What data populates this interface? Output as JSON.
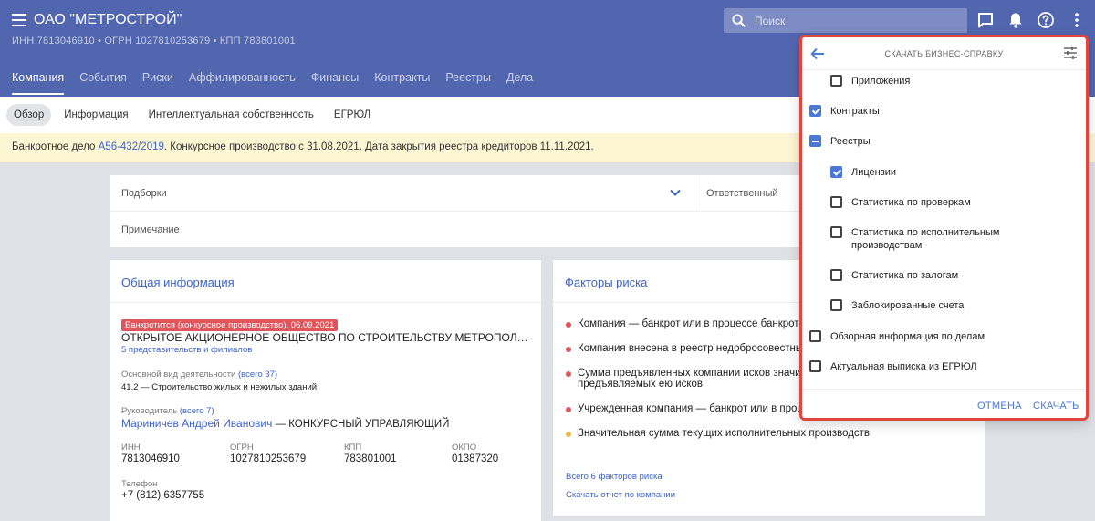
{
  "header": {
    "title": "ОАО \"МЕТРОСТРОЙ\"",
    "ids": "ИНН 7813046910  •  ОГРН 1027810253679  •  КПП 783801001",
    "search_placeholder": "Поиск",
    "tabs": [
      "Компания",
      "События",
      "Риски",
      "Аффилированность",
      "Финансы",
      "Контракты",
      "Реестры",
      "Дела"
    ]
  },
  "subnav": [
    "Обзор",
    "Информация",
    "Интеллектуальная собственность",
    "ЕГРЮЛ"
  ],
  "banner": {
    "prefix": "Банкротное дело ",
    "case_link": "А56-432/2019",
    "suffix": ". Конкурсное производство с 31.08.2021. Дата закрытия реестра кредиторов 11.11.2021."
  },
  "filters": {
    "collections_label": "Подборки",
    "responsible_label": "Ответственный",
    "note_label": "Примечание"
  },
  "general": {
    "title": "Общая информация",
    "badge": "Банкротится (конкурсное производство), 06.09.2021",
    "full_name": "ОТКРЫТОЕ АКЦИОНЕРНОЕ ОБЩЕСТВО ПО СТРОИТЕЛЬСТВУ МЕТРОПОЛИТЕНА В ГОР...",
    "branches_link": "5 представительств и филиалов",
    "activity_label": "Основной вид деятельности ",
    "activity_total": "(всего 37)",
    "activity_value": "41.2 — Строительство жилых и нежилых зданий",
    "head_label": "Руководитель ",
    "head_total": "(всего 7)",
    "head_name": "Мариничев Андрей Иванович",
    "head_role": " — КОНКУРСНЫЙ УПРАВЛЯЮЩИЙ",
    "inn_label": "ИНН",
    "inn": "7813046910",
    "ogrn_label": "ОГРН",
    "ogrn": "1027810253679",
    "kpp_label": "КПП",
    "kpp": "783801001",
    "okpo_label": "ОКПО",
    "okpo": "01387320",
    "phone_label": "Телефон",
    "phone": "+7 (812) 6357755"
  },
  "risks": {
    "title": "Факторы риска",
    "items": [
      "Компания — банкрот или в процессе банкротства",
      "Компания внесена в реестр недобросовестных",
      "Сумма предъявленных компании исков значит",
      "предъявляемых ею исков",
      "Учрежденная компания — банкрот или в проце",
      "Значительная сумма текущих исполнительных производств"
    ],
    "all_link": "Всего 6 факторов риска",
    "report_link": "Скачать отчет по компании"
  },
  "dialog": {
    "title": "СКАЧАТЬ БИЗНЕС-СПРАВКУ",
    "options": [
      {
        "label": "Приложения",
        "state": "unchecked"
      },
      {
        "label": "Контракты",
        "state": "checked"
      },
      {
        "label": "Реестры",
        "state": "indeterminate"
      },
      {
        "label": "Лицензии",
        "state": "checked"
      },
      {
        "label": "Статистика по проверкам",
        "state": "unchecked"
      },
      {
        "label": "Статистика по исполнительным производствам",
        "state": "unchecked"
      },
      {
        "label": "Статистика по залогам",
        "state": "unchecked"
      },
      {
        "label": "Заблокированные счета",
        "state": "unchecked"
      },
      {
        "label": "Обзорная информация по делам",
        "state": "unchecked"
      },
      {
        "label": "Актуальная выписка из ЕГРЮЛ",
        "state": "unchecked"
      }
    ],
    "cancel": "ОТМЕНА",
    "download": "СКАЧАТЬ"
  },
  "colors": {
    "header_bg": "#5266b0",
    "accent": "#4a78d6",
    "danger": "#e0545c",
    "warning": "#e9b949",
    "highlight_border": "#e1463c"
  }
}
